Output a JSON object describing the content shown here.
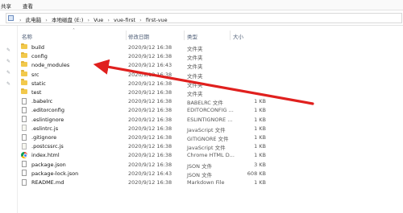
{
  "ribbon": {
    "tabs": [
      "共享",
      "查看"
    ]
  },
  "address": {
    "crumbs": [
      "此电脑",
      "本地磁盘 (E:)",
      "Vue",
      "vue-first",
      "first-vue"
    ]
  },
  "columns": {
    "name": "名称",
    "date": "修改日期",
    "type": "类型",
    "size": "大小"
  },
  "files": [
    {
      "name": "build",
      "date": "2020/9/12 16:38",
      "type": "文件夹",
      "size": "",
      "icon": "folder-icon"
    },
    {
      "name": "config",
      "date": "2020/9/12 16:38",
      "type": "文件夹",
      "size": "",
      "icon": "folder-icon"
    },
    {
      "name": "node_modules",
      "date": "2020/9/12 16:43",
      "type": "文件夹",
      "size": "",
      "icon": "folder-icon"
    },
    {
      "name": "src",
      "date": "2020/9/12 16:38",
      "type": "文件夹",
      "size": "",
      "icon": "folder-icon"
    },
    {
      "name": "static",
      "date": "2020/9/12 16:38",
      "type": "文件夹",
      "size": "",
      "icon": "folder-icon"
    },
    {
      "name": "test",
      "date": "2020/9/12 16:38",
      "type": "文件夹",
      "size": "",
      "icon": "folder-icon"
    },
    {
      "name": ".babelrc",
      "date": "2020/9/12 16:38",
      "type": "BABELRC 文件",
      "size": "1 KB",
      "icon": "file-icon"
    },
    {
      "name": ".editorconfig",
      "date": "2020/9/12 16:38",
      "type": "EDITORCONFIG ...",
      "size": "1 KB",
      "icon": "file-icon"
    },
    {
      "name": ".eslintignore",
      "date": "2020/9/12 16:38",
      "type": "ESLINTIGNORE ...",
      "size": "1 KB",
      "icon": "file-icon"
    },
    {
      "name": ".eslintrc.js",
      "date": "2020/9/12 16:38",
      "type": "JavaScript 文件",
      "size": "1 KB",
      "icon": "js-file-icon"
    },
    {
      "name": ".gitignore",
      "date": "2020/9/12 16:38",
      "type": "GITIGNORE 文件",
      "size": "1 KB",
      "icon": "file-icon"
    },
    {
      "name": ".postcssrc.js",
      "date": "2020/9/12 16:38",
      "type": "JavaScript 文件",
      "size": "1 KB",
      "icon": "js-file-icon"
    },
    {
      "name": "index.html",
      "date": "2020/9/12 16:38",
      "type": "Chrome HTML D...",
      "size": "1 KB",
      "icon": "chrome-icon"
    },
    {
      "name": "package.json",
      "date": "2020/9/12 16:38",
      "type": "JSON 文件",
      "size": "3 KB",
      "icon": "json-file-icon"
    },
    {
      "name": "package-lock.json",
      "date": "2020/9/12 16:43",
      "type": "JSON 文件",
      "size": "608 KB",
      "icon": "json-file-icon"
    },
    {
      "name": "README.md",
      "date": "2020/9/12 16:38",
      "type": "Markdown File",
      "size": "1 KB",
      "icon": "markdown-file-icon"
    }
  ],
  "annotation": {
    "arrow_color": "#e0201e",
    "points_to": "node_modules"
  },
  "colors": {
    "folder": "#f2c94c",
    "header_text": "#4a5a73",
    "arrow": "#e0201e"
  }
}
